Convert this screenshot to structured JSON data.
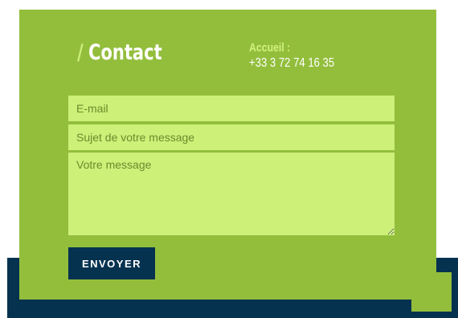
{
  "contact": {
    "title_slash": "/",
    "title": "Contact",
    "phone_label": "Accueil :",
    "phone_number": "+33 3 72 74 16 35"
  },
  "form": {
    "email_placeholder": "E-mail",
    "subject_placeholder": "Sujet de votre message",
    "message_placeholder": "Votre message",
    "submit_label": "ENVOYER"
  },
  "colors": {
    "card_green": "#93be3c",
    "input_green": "#ccf078",
    "navy": "#04324f",
    "label_lime": "#d2f27d"
  }
}
